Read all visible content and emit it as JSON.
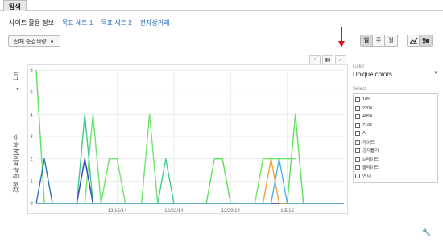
{
  "top_tab": {
    "label": "탐색"
  },
  "subnav": {
    "items": [
      {
        "label": "사이트 활용 정보",
        "active": true
      },
      {
        "label": "목표 세트 1",
        "active": false
      },
      {
        "label": "목표 세트 2",
        "active": false
      },
      {
        "label": "전자상거래",
        "active": false
      }
    ]
  },
  "metric_dropdown": {
    "label": "전체 순검색량"
  },
  "period_buttons": [
    {
      "label": "일",
      "active": true
    },
    {
      "label": "주",
      "active": false
    },
    {
      "label": "월",
      "active": false
    }
  ],
  "chart_type_buttons": [
    {
      "icon": "line-chart-icon",
      "active": false
    },
    {
      "icon": "motion-chart-icon",
      "active": true
    }
  ],
  "mini_chart_buttons": [
    {
      "icon": "bubble-view-icon"
    },
    {
      "icon": "bar-view-icon"
    },
    {
      "icon": "line-view-icon"
    }
  ],
  "annotation_arrow_color": "#d9121b",
  "scale": {
    "label": "Lin"
  },
  "y_axis_label": "검색 결과 페이지뷰 수",
  "side_panel": {
    "color_label": "Color",
    "color_value": "Unique colors",
    "select_label": "Select",
    "series_names": [
      "105",
      "2200",
      "4950",
      "7105",
      "A",
      "가이드",
      "공지틀러",
      "브레이드",
      "블레이드",
      "연시"
    ]
  },
  "chart_data": {
    "type": "line",
    "ylim": [
      0,
      6
    ],
    "y_ticks": [
      0,
      1,
      2,
      3,
      4,
      5,
      6
    ],
    "x_ticks": [
      "12/15/14",
      "12/22/14",
      "12/29/14",
      "1/5/15"
    ],
    "x_tick_days": [
      10,
      17,
      24,
      31
    ],
    "x_day_range": [
      0,
      38
    ],
    "series": [
      {
        "color": "#5fe05f",
        "points": [
          [
            0,
            6
          ],
          [
            1,
            0
          ],
          [
            21,
            0
          ],
          [
            22,
            2
          ],
          [
            23,
            2
          ],
          [
            24,
            0
          ],
          [
            31,
            0
          ],
          [
            32,
            4
          ],
          [
            33,
            0
          ],
          [
            37,
            0
          ],
          [
            38,
            0
          ]
        ]
      },
      {
        "color": "#2f6fc0",
        "points": [
          [
            0,
            0
          ],
          [
            1,
            2
          ],
          [
            2,
            0
          ],
          [
            5,
            0
          ],
          [
            6,
            2
          ],
          [
            7,
            0
          ],
          [
            38,
            0
          ]
        ]
      },
      {
        "color": "#43c98c",
        "points": [
          [
            0,
            0
          ],
          [
            5,
            0
          ],
          [
            6,
            4
          ],
          [
            7,
            0
          ],
          [
            15,
            0
          ],
          [
            16,
            2
          ],
          [
            17,
            0
          ],
          [
            38,
            0
          ]
        ]
      },
      {
        "color": "#6ee36e",
        "points": [
          [
            0,
            0
          ],
          [
            6,
            0
          ],
          [
            7,
            4
          ],
          [
            8,
            0
          ],
          [
            9,
            2
          ],
          [
            10,
            2
          ],
          [
            11,
            0
          ],
          [
            13,
            0
          ],
          [
            14,
            4
          ],
          [
            15,
            0
          ],
          [
            27,
            0
          ],
          [
            28,
            2
          ],
          [
            29,
            2
          ],
          [
            30,
            2
          ],
          [
            31,
            2
          ],
          [
            32,
            2
          ]
        ]
      },
      {
        "color": "#4a4ac8",
        "points": [
          [
            0,
            0
          ],
          [
            5,
            0
          ],
          [
            6,
            2
          ],
          [
            7,
            0
          ],
          [
            38,
            0
          ]
        ]
      },
      {
        "color": "#f2a33a",
        "points": [
          [
            0,
            0
          ],
          [
            28,
            0
          ],
          [
            29,
            2
          ],
          [
            30,
            0
          ],
          [
            38,
            0
          ]
        ]
      },
      {
        "color": "#4fb3e6",
        "points": [
          [
            0,
            0
          ],
          [
            29,
            0
          ],
          [
            30,
            2
          ],
          [
            31,
            0
          ],
          [
            38,
            0
          ]
        ]
      }
    ]
  }
}
